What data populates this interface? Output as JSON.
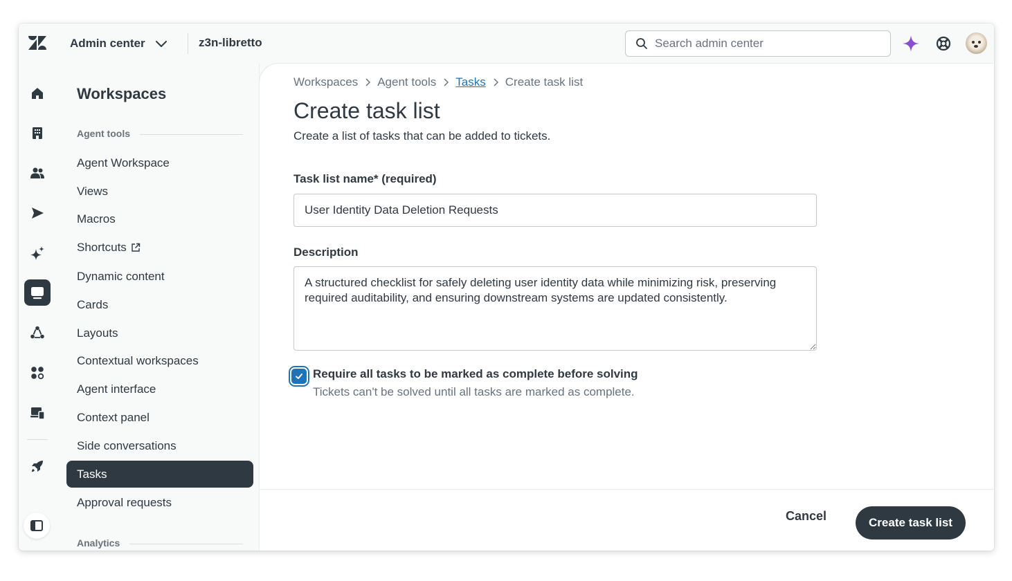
{
  "topbar": {
    "logo_icon": "zendesk-logo-icon",
    "product": "Admin center",
    "account": "z3n-libretto",
    "search_placeholder": "Search admin center"
  },
  "rail": {
    "items": [
      "home-icon",
      "buildings-icon",
      "people-icon",
      "channels-icon",
      "sparkle-icon",
      "workspaces-icon",
      "objects-icon",
      "apps-icon",
      "account-icon",
      "rocket-icon"
    ],
    "active": "workspaces-icon"
  },
  "sidebar": {
    "title": "Workspaces",
    "section_agent_tools": "Agent tools",
    "items": [
      {
        "label": "Agent Workspace"
      },
      {
        "label": "Views"
      },
      {
        "label": "Macros"
      },
      {
        "label": "Shortcuts"
      },
      {
        "label": "Dynamic content"
      },
      {
        "label": "Cards"
      },
      {
        "label": "Layouts"
      },
      {
        "label": "Contextual workspaces"
      },
      {
        "label": "Agent interface"
      },
      {
        "label": "Context panel"
      },
      {
        "label": "Side conversations"
      },
      {
        "label": "Tasks"
      },
      {
        "label": "Approval requests"
      }
    ],
    "active_item": "Tasks",
    "section_analytics": "Analytics"
  },
  "breadcrumb": {
    "items": [
      "Workspaces",
      "Agent tools",
      "Tasks",
      "Create task list"
    ]
  },
  "page": {
    "title": "Create task list",
    "subtitle": "Create a list of tasks that can be added to tickets."
  },
  "form": {
    "name_label": "Task list name* (required)",
    "name_value": "User Identity Data Deletion Requests",
    "description_label": "Description",
    "description_value": "A structured checklist for safely deleting user identity data while minimizing risk, preserving required auditability, and ensuring downstream systems are updated consistently.",
    "require_complete_checked": true,
    "require_complete_label": "Require all tasks to be marked as complete before solving",
    "require_complete_hint": "Tickets can't be solved until all tasks are marked as complete."
  },
  "footer": {
    "cancel_label": "Cancel",
    "create_label": "Create task list"
  },
  "colors": {
    "primary_dark": "#2f3941",
    "link": "#1f73b7",
    "ai_accent": "#8a4fd1"
  }
}
